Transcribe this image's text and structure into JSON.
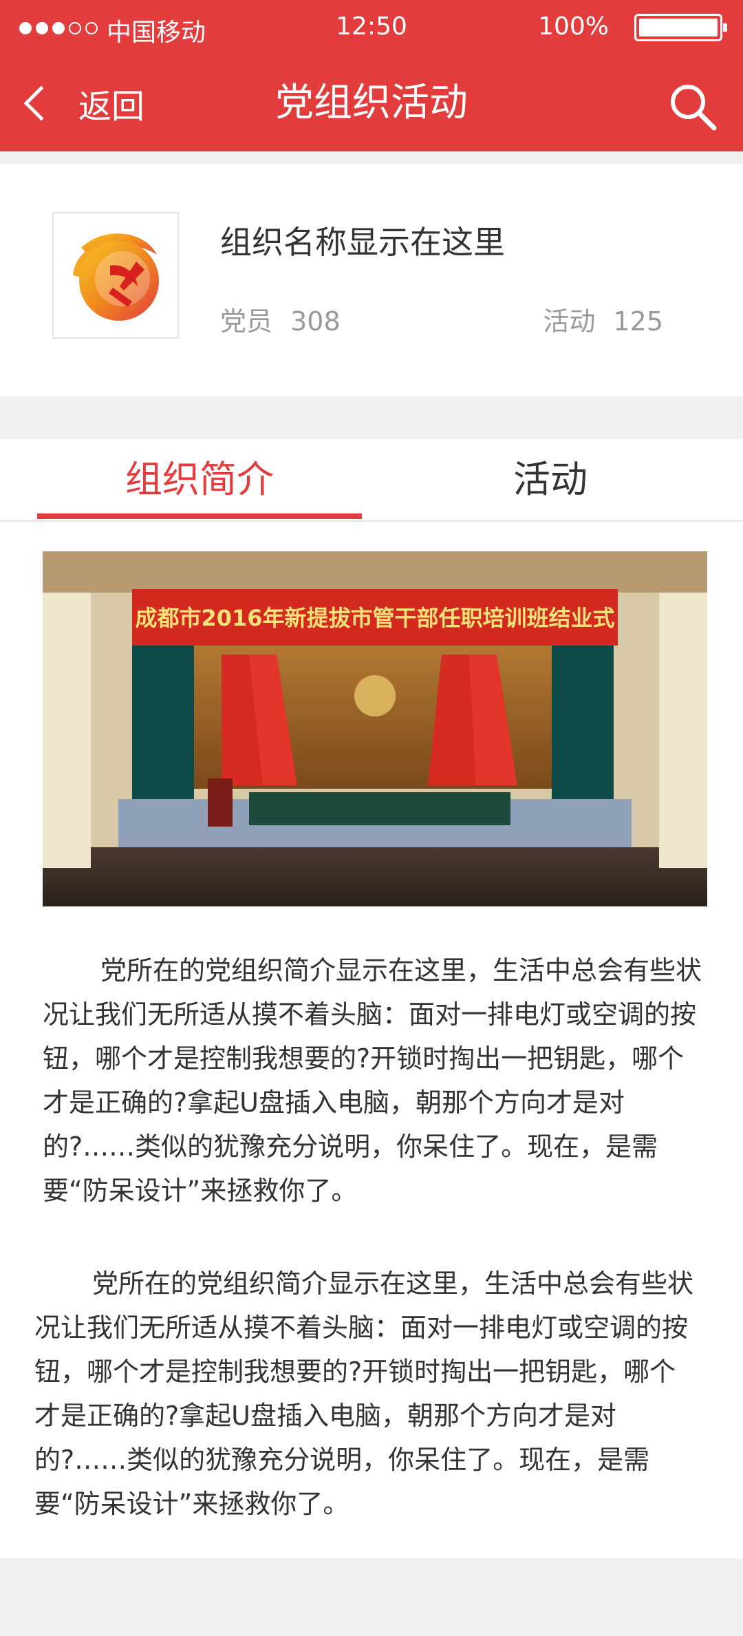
{
  "status_bar": {
    "carrier": "中国移动",
    "time": "12:50",
    "battery": "100%"
  },
  "nav": {
    "back_label": "返回",
    "title": "党组织活动"
  },
  "org": {
    "name": "组织名称显示在这里",
    "members_label": "党员",
    "members_count": "308",
    "activities_label": "活动",
    "activities_count": "125"
  },
  "tabs": [
    {
      "label": "组织简介",
      "active": true
    },
    {
      "label": "活动",
      "active": false
    }
  ],
  "content": {
    "banner_text": "成都市2016年新提拔市管干部任职培训班结业式",
    "paragraphs": [
      "党所在的党组织简介显示在这里，生活中总会有些状况让我们无所适从摸不着头脑：面对一排电灯或空调的按钮，哪个才是控制我想要的?开锁时掏出一把钥匙，哪个才是正确的?拿起U盘插入电脑，朝那个方向才是对的?……类似的犹豫充分说明，你呆住了。现在，是需要“防呆设计”来拯救你了。",
      "党所在的党组织简介显示在这里，生活中总会有些状况让我们无所适从摸不着头脑：面对一排电灯或空调的按钮，哪个才是控制我想要的?开锁时掏出一把钥匙，哪个才是正确的?拿起U盘插入电脑，朝那个方向才是对的?……类似的犹豫充分说明，你呆住了。现在，是需要“防呆设计”来拯救你了。"
    ]
  },
  "colors": {
    "accent": "#e23c3c",
    "muted_text": "#999999",
    "background": "#efefef"
  },
  "icons": [
    "back-chevron-icon",
    "search-icon",
    "party-emblem-logo"
  ]
}
